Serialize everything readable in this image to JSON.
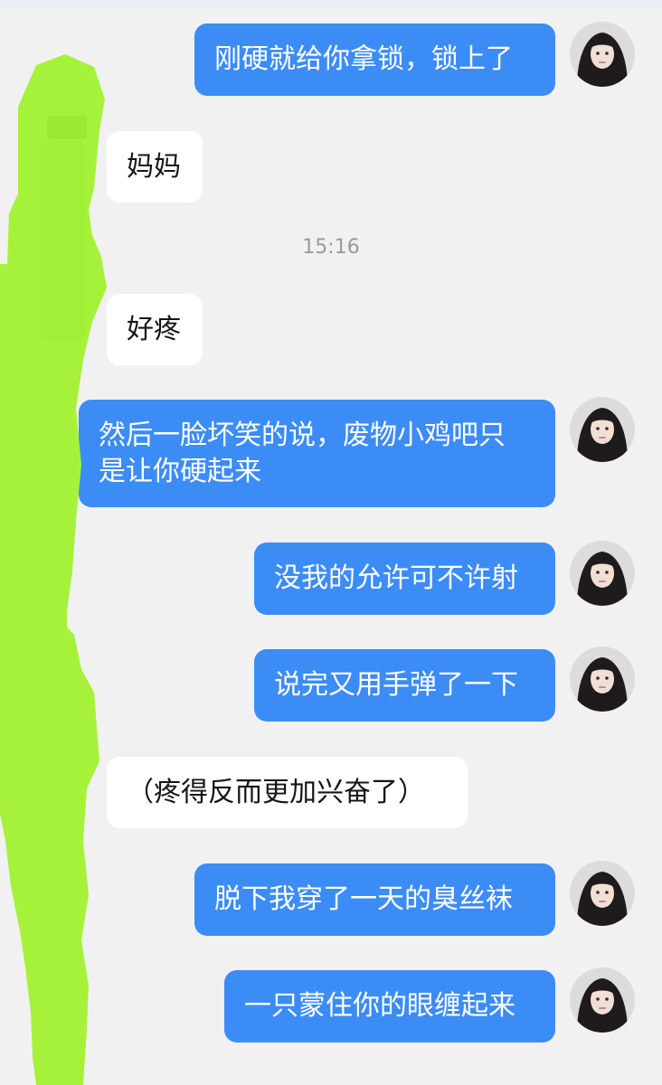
{
  "timestamp": "15:16",
  "messages": [
    {
      "side": "out",
      "text": "刚硬就给你拿锁，锁上了"
    },
    {
      "side": "in",
      "text": "妈妈"
    },
    {
      "side": "in",
      "text": "好疼"
    },
    {
      "side": "out",
      "lines": [
        "然后一脸坏笑的说，废物小鸡吧只",
        "是让你硬起来"
      ]
    },
    {
      "side": "out",
      "text": "没我的允许可不许射"
    },
    {
      "side": "out",
      "text": "说完又用手弹了一下"
    },
    {
      "side": "in",
      "text": "（疼得反而更加兴奋了）"
    },
    {
      "side": "out",
      "text": "脱下我穿了一天的臭丝袜"
    },
    {
      "side": "out",
      "text": "一只蒙住你的眼缠起来"
    }
  ],
  "colors": {
    "outgoing_bubble": "#3c8cf6",
    "incoming_bubble": "#ffffff",
    "background": "#f1f1f1",
    "redaction": "#a6f23a"
  },
  "icons": {
    "user_avatar": "avatar-icon"
  }
}
